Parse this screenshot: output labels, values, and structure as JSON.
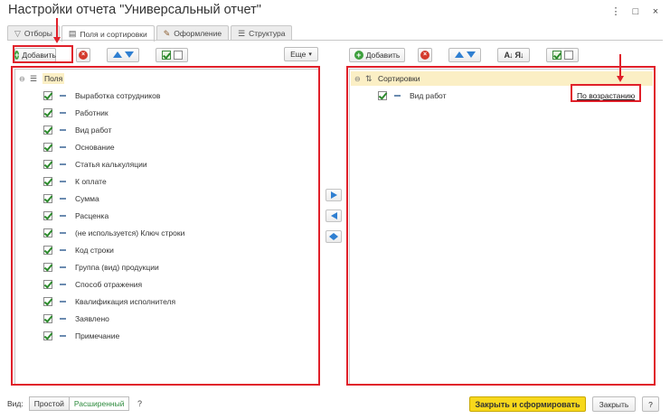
{
  "window": {
    "title": "Настройки отчета \"Универсальный отчет\"",
    "controls": [
      "⋮",
      "□",
      "×"
    ]
  },
  "tabs": [
    {
      "label": "Отборы",
      "icon": "filter-icon",
      "active": false
    },
    {
      "label": "Поля и сортировки",
      "icon": "fields-icon",
      "active": true
    },
    {
      "label": "Оформление",
      "icon": "brush-icon",
      "active": false
    },
    {
      "label": "Структура",
      "icon": "structure-icon",
      "active": false
    }
  ],
  "left_toolbar": {
    "add_label": "Добавить",
    "more_label": "Еще",
    "more_arrow": "▾"
  },
  "right_toolbar": {
    "add_label": "Добавить"
  },
  "fields": {
    "root_label": "Поля",
    "items": [
      "Выработка сотрудников",
      "Работник",
      "Вид работ",
      "Основание",
      "Статья калькуляции",
      "К оплате",
      "Сумма",
      "Расценка",
      "(не используется) Ключ строки",
      "Код строки",
      "Группа (вид) продукции",
      "Способ отражения",
      "Квалификация исполнителя",
      "Заявлено",
      "Примечание"
    ]
  },
  "sorting": {
    "root_label": "Сортировки",
    "items": [
      {
        "field": "Вид работ",
        "direction": "По возрастанию"
      }
    ]
  },
  "bottom": {
    "view_label": "Вид:",
    "simple_label": "Простой",
    "extended_label": "Расширенный",
    "help_label": "?",
    "primary_label": "Закрыть и сформировать",
    "close_label": "Закрыть",
    "question_label": "?"
  },
  "colors": {
    "accent_yellow": "#f7d81c",
    "highlight_red": "#e0202a",
    "header_row": "#fbefc5",
    "check_green": "#2c8a2c",
    "arrow_blue": "#2f7fd1"
  }
}
